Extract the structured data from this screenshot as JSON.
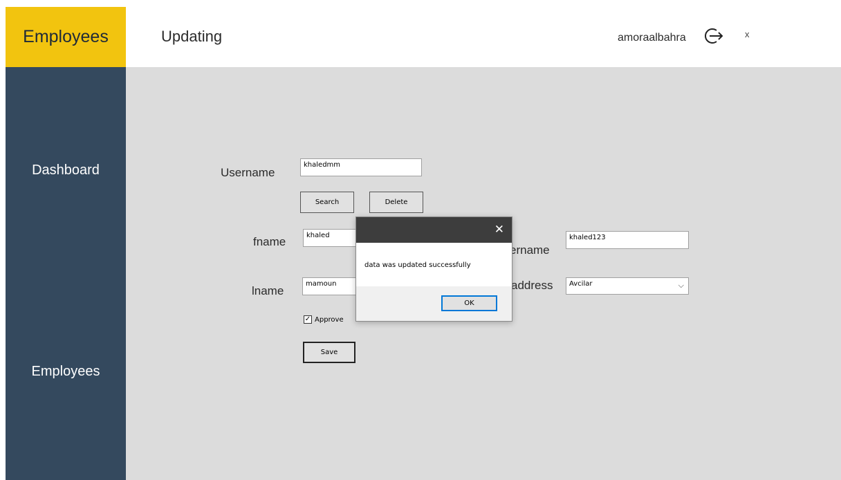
{
  "brand": {
    "title": "Employees"
  },
  "header": {
    "title": "Updating",
    "username": "amoraalbahra",
    "logout_icon": "logout-icon",
    "close_label": "x"
  },
  "sidebar": {
    "items": [
      {
        "label": "Dashboard"
      },
      {
        "label": "Employees"
      }
    ]
  },
  "form": {
    "username_label": "Username",
    "username_value": "khaledmm",
    "search_label": "Search",
    "delete_label": "Delete",
    "fname_label": "fname",
    "fname_value": "khaled",
    "lname_label": "lname",
    "lname_value": "mamoun",
    "approve_label": "Approve",
    "approve_checked": true,
    "save_label": "Save",
    "username2_label_visible": "ername",
    "username2_value": "khaled123",
    "address_label": "address",
    "address_value": "Avcilar"
  },
  "dialog": {
    "message": "data was updated successfully",
    "ok_label": "OK",
    "close_glyph": "✕"
  },
  "colors": {
    "brand_yellow": "#f2c40f",
    "sidebar": "#34495e",
    "content_bg": "#dcdcdc",
    "dialog_title": "#3d3d3d",
    "focus_blue": "#0078d7"
  }
}
